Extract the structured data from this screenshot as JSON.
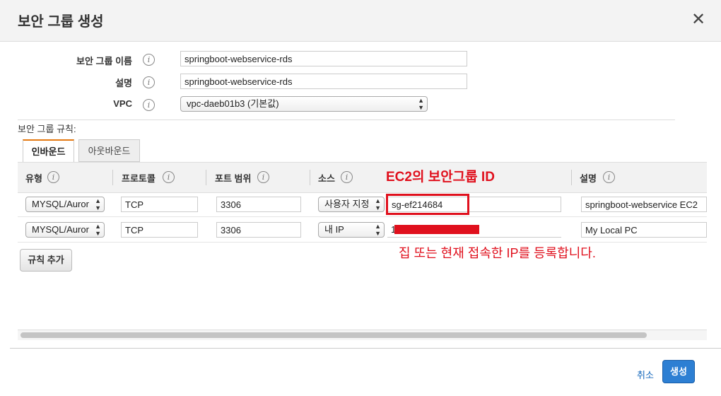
{
  "dialog": {
    "title": "보안 그룹 생성",
    "close_symbol": "✕"
  },
  "form": {
    "name_label": "보안 그룹 이름",
    "name_value": "springboot-webservice-rds",
    "desc_label": "설명",
    "desc_value": "springboot-webservice-rds",
    "vpc_label": "VPC",
    "vpc_value": "vpc-daeb01b3 (기본값)",
    "info_symbol": "i"
  },
  "rules": {
    "section_title": "보안 그룹 규칙:",
    "tabs": [
      "인바운드",
      "아웃바운드"
    ],
    "columns": [
      "유형",
      "프로토콜",
      "포트 범위",
      "소스",
      "설명"
    ],
    "rows": [
      {
        "type": "MYSQL/Auror",
        "protocol": "TCP",
        "port": "3306",
        "source_type": "사용자 지정",
        "source_value": "sg-ef214684",
        "description": "springboot-webservice EC2"
      },
      {
        "type": "MYSQL/Auror",
        "protocol": "TCP",
        "port": "3306",
        "source_type": "내 IP",
        "source_value": "1",
        "description": "My Local PC"
      }
    ],
    "add_rule_label": "규칙 추가"
  },
  "annotations": {
    "title": "EC2의 보안그룹 ID",
    "note": "집 또는 현재 접속한 IP를 등록합니다."
  },
  "footer": {
    "cancel_label": "취소",
    "create_label": "생성"
  },
  "colors": {
    "annotation": "#e0101d",
    "primary_button": "#2d7fd3",
    "active_tab_accent": "#e47911"
  }
}
